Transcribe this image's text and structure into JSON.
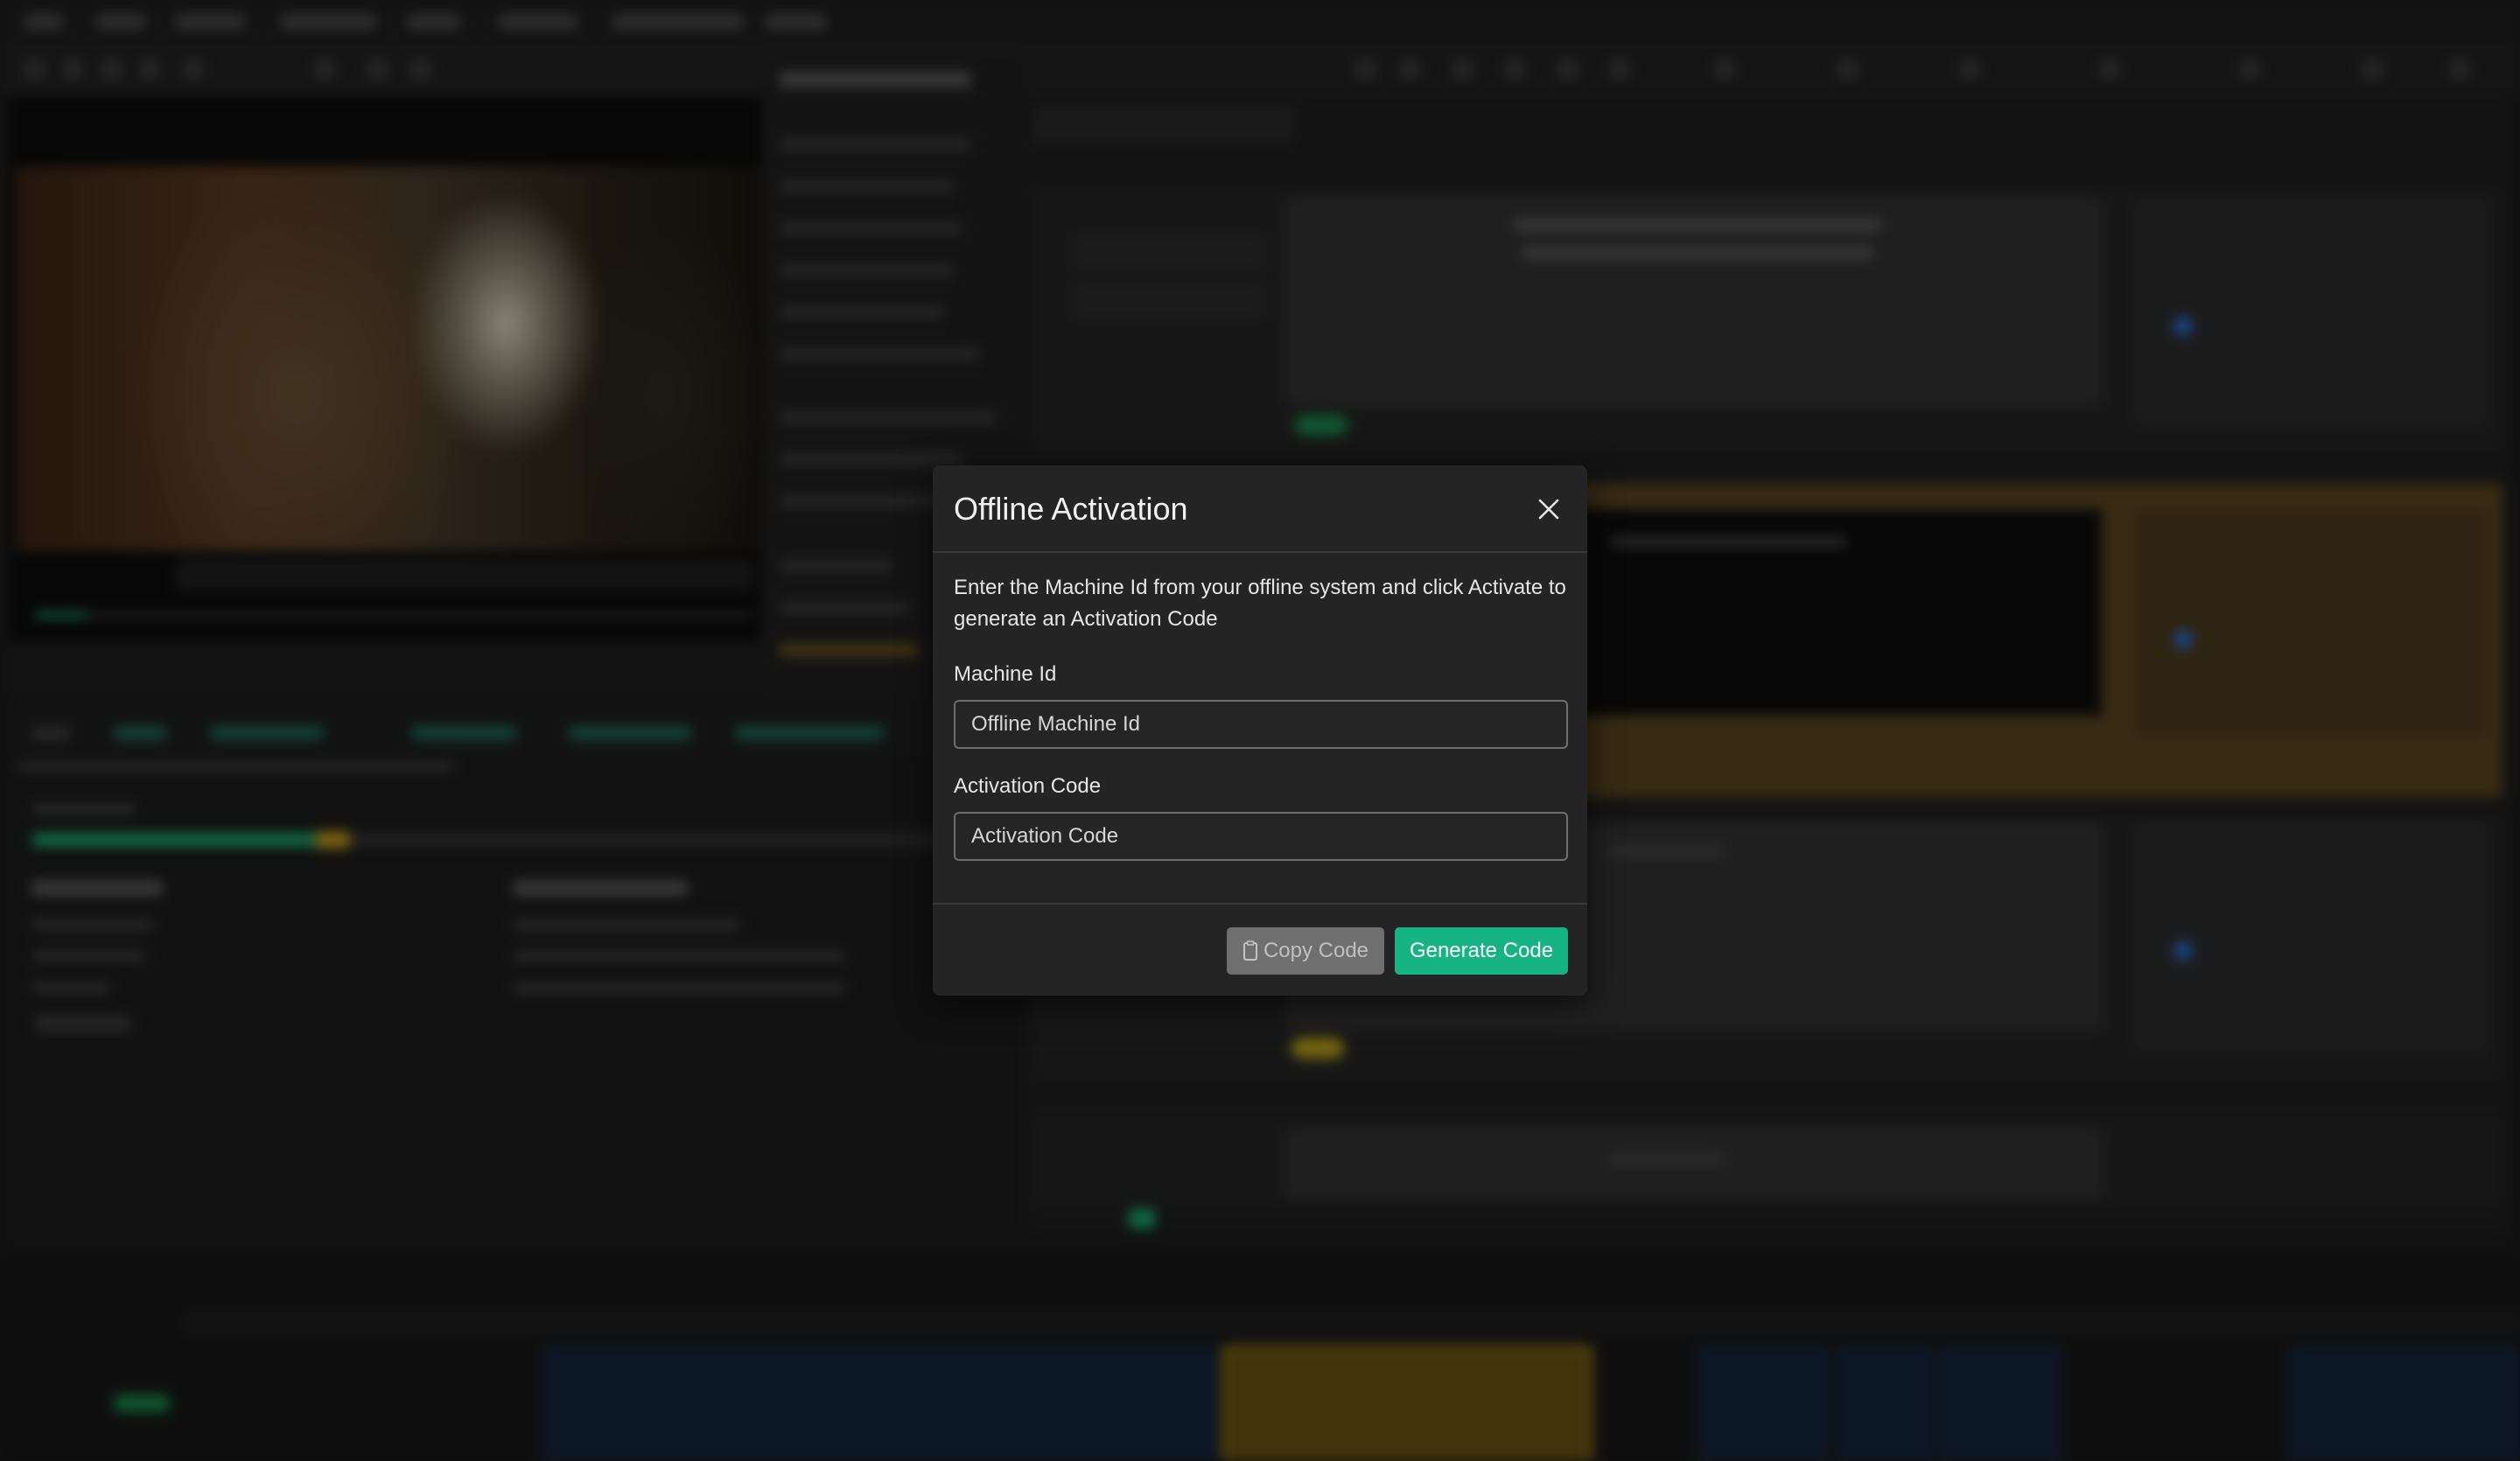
{
  "modal": {
    "title": "Offline Activation",
    "description": "Enter the Machine Id from your offline system and click Activate to generate an Activation Code",
    "machine_id": {
      "label": "Machine Id",
      "value": "",
      "placeholder": "Offline Machine Id"
    },
    "activation_code": {
      "label": "Activation Code",
      "value": "",
      "placeholder": "Activation Code"
    },
    "buttons": {
      "copy_label": "Copy Code",
      "generate_label": "Generate Code"
    },
    "icons": {
      "close": "close-icon",
      "copy": "clipboard-icon"
    }
  },
  "colors": {
    "accent": "#16b383",
    "modal_background": "#242424",
    "disabled_button": "#6f6f6f"
  }
}
